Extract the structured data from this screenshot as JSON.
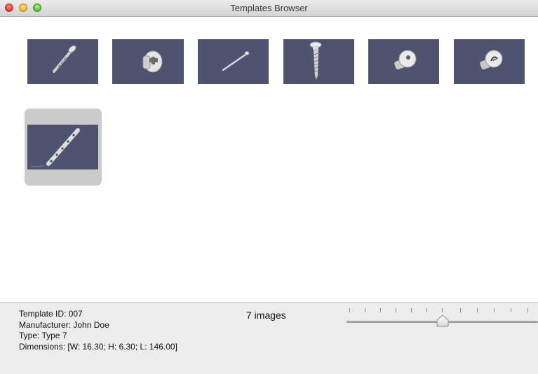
{
  "window": {
    "title": "Templates Browser"
  },
  "thumbnails": [
    {
      "name": "screw-diagonal",
      "selected": false
    },
    {
      "name": "flathead-bolt",
      "selected": false
    },
    {
      "name": "long-pin",
      "selected": false
    },
    {
      "name": "panhead-screw",
      "selected": false
    },
    {
      "name": "round-head-bolt",
      "selected": false
    },
    {
      "name": "socket-head-bolt",
      "selected": false
    },
    {
      "name": "strip-rail",
      "selected": true
    }
  ],
  "details": {
    "template_id": "Template ID: 007",
    "manufacturer": "Manufacturer: John Doe",
    "type": "Type: Type 7",
    "dimensions": "Dimensions: [W: 16.30; H: 6.30; L: 146.00]"
  },
  "image_count": "7 images",
  "zoom_slider": {
    "value_fraction": 0.5
  },
  "colors": {
    "thumb_bg": "#4f5370",
    "selection": "#cbcbcb"
  }
}
